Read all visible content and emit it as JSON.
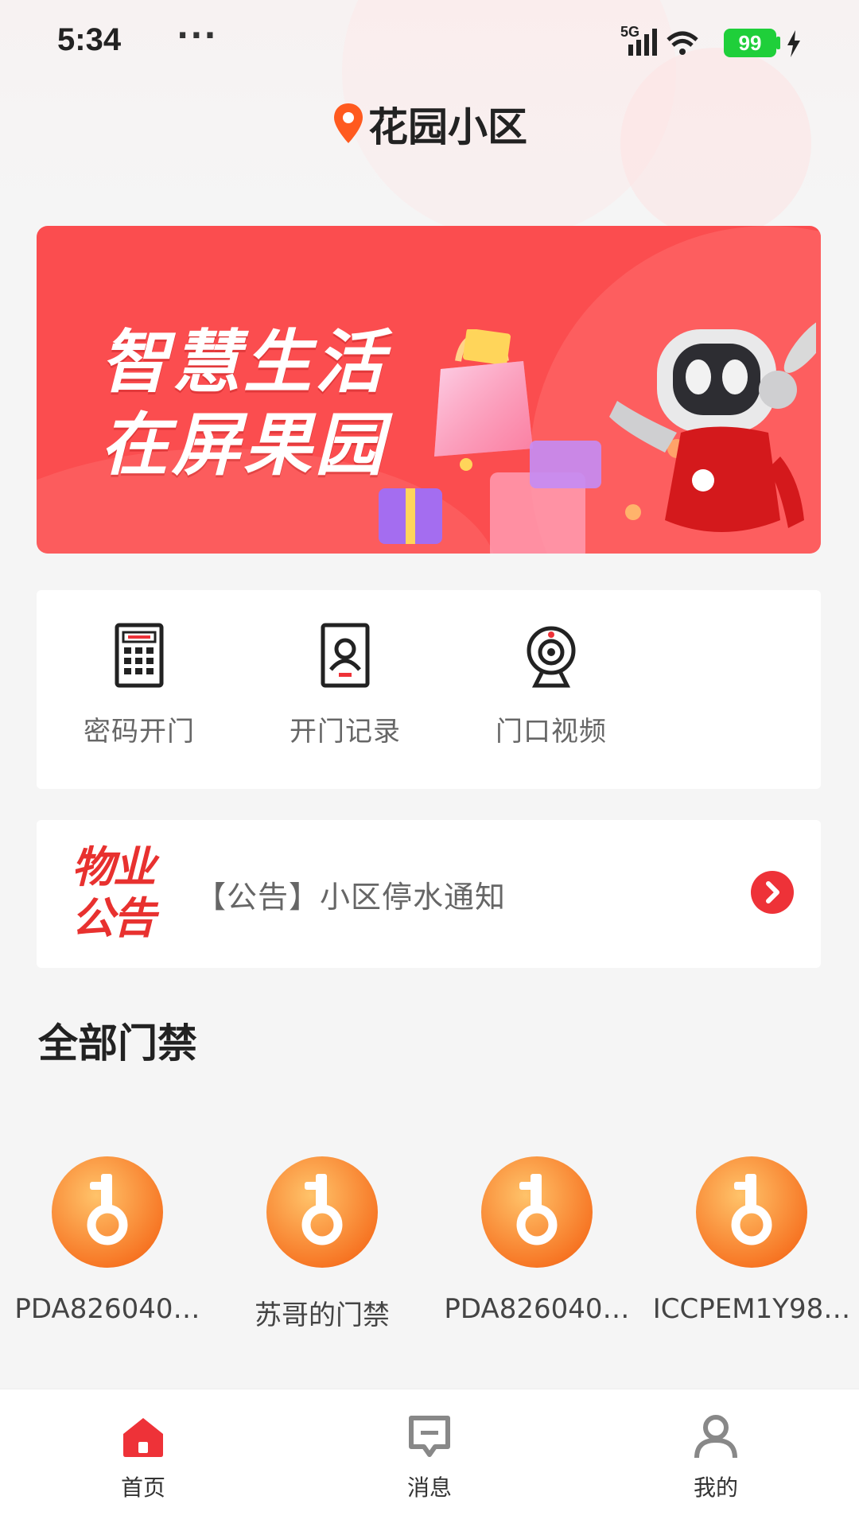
{
  "status_bar": {
    "time": "5:34",
    "more_dots": "···",
    "network": "5G",
    "battery": "99"
  },
  "header": {
    "title": "花园小区",
    "icon": "location-pin-icon"
  },
  "banner": {
    "line1": "智慧生活",
    "line2": "在屏果园"
  },
  "actions": [
    {
      "label": "密码开门",
      "icon": "calculator-icon"
    },
    {
      "label": "开门记录",
      "icon": "id-record-icon"
    },
    {
      "label": "门口视频",
      "icon": "camera-icon"
    }
  ],
  "notice": {
    "badge_line1": "物业",
    "badge_line2": "公告",
    "text": "【公告】小区停水通知"
  },
  "section": {
    "title": "全部门禁"
  },
  "doors": [
    {
      "label": "PDA826040…",
      "icon": "key-icon"
    },
    {
      "label": "苏哥的门禁",
      "icon": "key-icon"
    },
    {
      "label": "PDA826040…",
      "icon": "key-icon"
    },
    {
      "label": "ICCPEM1Y98…",
      "icon": "key-icon"
    }
  ],
  "tabs": [
    {
      "label": "首页",
      "icon": "home-icon",
      "active": true
    },
    {
      "label": "消息",
      "icon": "message-icon",
      "active": false
    },
    {
      "label": "我的",
      "icon": "user-icon",
      "active": false
    }
  ],
  "colors": {
    "brand_red": "#ee3238",
    "key_orange": "#f77b22",
    "battery_green": "#1fcf3a"
  }
}
